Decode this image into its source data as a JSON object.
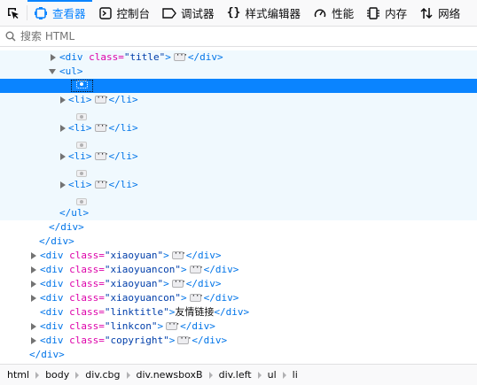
{
  "toolbar": {
    "tabs": [
      {
        "label": "查看器",
        "icon": "inspector-icon",
        "selected": true
      },
      {
        "label": "控制台",
        "icon": "console-icon"
      },
      {
        "label": "调试器",
        "icon": "debugger-icon"
      },
      {
        "label": "样式编辑器",
        "icon": "style-editor-icon"
      },
      {
        "label": "性能",
        "icon": "performance-icon"
      },
      {
        "label": "内存",
        "icon": "memory-icon"
      },
      {
        "label": "网络",
        "icon": "network-icon"
      }
    ],
    "accent": "#0a84ff"
  },
  "search": {
    "placeholder": "搜索 HTML"
  },
  "tree": {
    "r0": {
      "tag_open": "<div",
      "attr": " class=",
      "val": "\"title\"",
      "close_bracket": ">",
      "end": "</div>"
    },
    "r1": {
      "text": "<ul>"
    },
    "r3": {
      "open": "<li>",
      "close": "</li>"
    },
    "r5": {
      "open": "<li>",
      "close": "</li>"
    },
    "r7": {
      "open": "<li>",
      "close": "</li>"
    },
    "r9": {
      "open": "<li>",
      "close": "</li>"
    },
    "r11": {
      "text": "</ul>"
    },
    "r12": {
      "text": "</div>"
    },
    "r13": {
      "text": "</div>"
    },
    "r14": {
      "open": "<div",
      "attr": " class=",
      "val": "\"xiaoyuan\"",
      "gt": ">",
      "close": "</div>"
    },
    "r15": {
      "open": "<div",
      "attr": " class=",
      "val": "\"xiaoyuancon\"",
      "gt": ">",
      "close": "</div>"
    },
    "r16": {
      "open": "<div",
      "attr": " class=",
      "val": "\"xiaoyuan\"",
      "gt": ">",
      "close": "</div>"
    },
    "r17": {
      "open": "<div",
      "attr": " class=",
      "val": "\"xiaoyuancon\"",
      "gt": ">",
      "close": "</div>"
    },
    "r18": {
      "open": "<div",
      "attr": " class=",
      "val": "\"linktitle\"",
      "gt": ">",
      "text": "友情链接",
      "close": "</div>"
    },
    "r19": {
      "open": "<div",
      "attr": " class=",
      "val": "\"linkcon\"",
      "gt": ">",
      "close": "</div>"
    },
    "r20": {
      "open": "<div",
      "attr": " class=",
      "val": "\"copyright\"",
      "gt": ">",
      "close": "</div>"
    },
    "r21": {
      "text": "</div>"
    }
  },
  "breadcrumbs": [
    "html",
    "body",
    "div.cbg",
    "div.newsboxB",
    "div.left",
    "ul",
    "li"
  ]
}
